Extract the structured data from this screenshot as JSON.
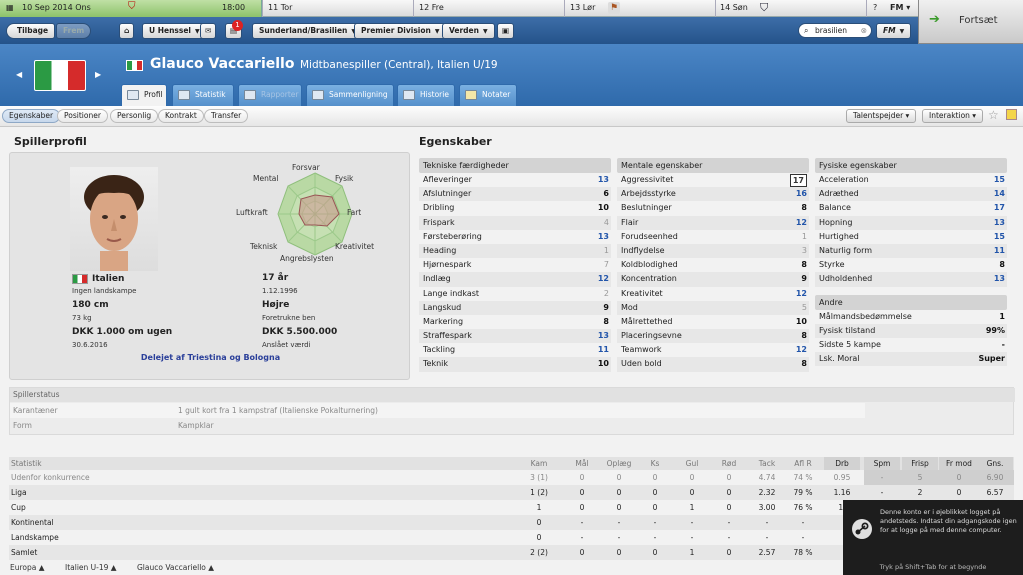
{
  "datebar": {
    "current_date": "10 Sep 2014 Ons",
    "time": "18:00",
    "days": [
      {
        "label": "11 Tor"
      },
      {
        "label": "12 Fre"
      },
      {
        "label": "13 Lør"
      },
      {
        "label": "14 Søn"
      }
    ],
    "help": "?",
    "fm_menu": "FM"
  },
  "nav": {
    "back": "Tilbage",
    "forward": "Frem",
    "manager": "U Henssel",
    "notification_count": "1",
    "club": "Sunderland/Brasilien",
    "league": "Premier Division",
    "world": "Verden",
    "search_value": "brasilien",
    "fm": "FM",
    "continue": "Fortsæt"
  },
  "player": {
    "name": "Glauco Vaccariello",
    "role": "Midtbanespiller (Central), Italien U/19"
  },
  "tabs": [
    {
      "label": "Profil"
    },
    {
      "label": "Statistik"
    },
    {
      "label": "Rapporter"
    },
    {
      "label": "Sammenligning"
    },
    {
      "label": "Historie"
    },
    {
      "label": "Notater"
    }
  ],
  "subtabs": [
    {
      "label": "Egenskaber"
    },
    {
      "label": "Positioner"
    },
    {
      "label": "Personlig"
    },
    {
      "label": "Kontrakt"
    },
    {
      "label": "Transfer"
    }
  ],
  "actions": {
    "scouts": "Talentspejder",
    "interaction": "Interaktion"
  },
  "profile": {
    "title": "Spillerprofil",
    "nationality": "Italien",
    "caps": "Ingen landskampe",
    "age": "17 år",
    "dob": "1.12.1996",
    "height": "180 cm",
    "weight": "73 kg",
    "foot": "Højre",
    "foot_label": "Foretrukne ben",
    "wage": "DKK 1.000 om ugen",
    "contract_end": "30.6.2016",
    "value": "DKK 5.500.000",
    "value_label": "Anslået værdi",
    "owned_by": "Delejet af Triestina og Bologna",
    "radar_labels": [
      "Forsvar",
      "Fysik",
      "Fart",
      "Kreativitet",
      "Angrebslysten",
      "Teknisk",
      "Luftkraft",
      "Mental"
    ]
  },
  "attributes": {
    "title": "Egenskaber",
    "technical": {
      "header": "Tekniske færdigheder",
      "rows": [
        {
          "name": "Afleveringer",
          "value": "13",
          "cls": "b"
        },
        {
          "name": "Afslutninger",
          "value": "6",
          "cls": "k"
        },
        {
          "name": "Dribling",
          "value": "10",
          "cls": "k"
        },
        {
          "name": "Frispark",
          "value": "4",
          "cls": "g"
        },
        {
          "name": "Førsteberøring",
          "value": "13",
          "cls": "b"
        },
        {
          "name": "Heading",
          "value": "1",
          "cls": "g"
        },
        {
          "name": "Hjørnespark",
          "value": "7",
          "cls": "g"
        },
        {
          "name": "Indlæg",
          "value": "12",
          "cls": "b"
        },
        {
          "name": "Lange indkast",
          "value": "2",
          "cls": "g"
        },
        {
          "name": "Langskud",
          "value": "9",
          "cls": "k"
        },
        {
          "name": "Markering",
          "value": "8",
          "cls": "k"
        },
        {
          "name": "Straffespark",
          "value": "13",
          "cls": "b"
        },
        {
          "name": "Tackling",
          "value": "11",
          "cls": "b"
        },
        {
          "name": "Teknik",
          "value": "10",
          "cls": "k"
        }
      ]
    },
    "mental": {
      "header": "Mentale egenskaber",
      "rows": [
        {
          "name": "Aggressivitet",
          "value": "17",
          "cls": "box"
        },
        {
          "name": "Arbejdsstyrke",
          "value": "16",
          "cls": "b"
        },
        {
          "name": "Beslutninger",
          "value": "8",
          "cls": "k"
        },
        {
          "name": "Flair",
          "value": "12",
          "cls": "b"
        },
        {
          "name": "Forudseenhed",
          "value": "1",
          "cls": "g"
        },
        {
          "name": "Indflydelse",
          "value": "3",
          "cls": "g"
        },
        {
          "name": "Koldblodighed",
          "value": "8",
          "cls": "k"
        },
        {
          "name": "Koncentration",
          "value": "9",
          "cls": "k"
        },
        {
          "name": "Kreativitet",
          "value": "12",
          "cls": "b"
        },
        {
          "name": "Mod",
          "value": "5",
          "cls": "g"
        },
        {
          "name": "Målrettethed",
          "value": "10",
          "cls": "k"
        },
        {
          "name": "Placeringsevne",
          "value": "8",
          "cls": "k"
        },
        {
          "name": "Teamwork",
          "value": "12",
          "cls": "b"
        },
        {
          "name": "Uden bold",
          "value": "8",
          "cls": "k"
        }
      ]
    },
    "physical": {
      "header": "Fysiske egenskaber",
      "rows": [
        {
          "name": "Acceleration",
          "value": "15",
          "cls": "b"
        },
        {
          "name": "Adræthed",
          "value": "14",
          "cls": "b"
        },
        {
          "name": "Balance",
          "value": "17",
          "cls": "b"
        },
        {
          "name": "Hopning",
          "value": "13",
          "cls": "b"
        },
        {
          "name": "Hurtighed",
          "value": "15",
          "cls": "b"
        },
        {
          "name": "Naturlig form",
          "value": "11",
          "cls": "b"
        },
        {
          "name": "Styrke",
          "value": "8",
          "cls": "k"
        },
        {
          "name": "Udholdenhed",
          "value": "13",
          "cls": "b"
        }
      ]
    },
    "other": {
      "header": "Andre",
      "rows": [
        {
          "name": "Målmandsbedømmelse",
          "value": "1",
          "cls": "k"
        },
        {
          "name": "Fysisk tilstand",
          "value": "99%",
          "cls": "k"
        },
        {
          "name": "Sidste 5 kampe",
          "value": "-",
          "cls": "k"
        },
        {
          "name": "Lsk. Moral",
          "value": "Super",
          "cls": "k"
        }
      ]
    }
  },
  "status": {
    "header": "Spillerstatus",
    "rows": [
      {
        "label": "Karantæner",
        "value": "1 gult kort fra 1 kampstraf (Italienske Pokalturnering)"
      },
      {
        "label": "Form",
        "value": "Kampklar"
      }
    ]
  },
  "stats": {
    "columns": [
      "Statistik",
      "Kam",
      "Mål",
      "Oplæg",
      "Ks",
      "Gul",
      "Rød",
      "Tack",
      "Afl R",
      "Drb",
      "Spm",
      "Frisp",
      "Fr mod",
      "Gns."
    ],
    "rows": [
      [
        "Udenfor konkurrence",
        "3 (1)",
        "0",
        "0",
        "0",
        "0",
        "0",
        "4.74",
        "74 %",
        "0.95",
        "-",
        "5",
        "0",
        "6.90"
      ],
      [
        "Liga",
        "1 (2)",
        "0",
        "0",
        "0",
        "0",
        "0",
        "2.32",
        "79 %",
        "1.16",
        "-",
        "2",
        "0",
        "6.57"
      ],
      [
        "Cup",
        "1",
        "0",
        "0",
        "0",
        "1",
        "0",
        "3.00",
        "76 %",
        "1.",
        "",
        "",
        "",
        ""
      ],
      [
        "Kontinental",
        "0",
        "-",
        "-",
        "-",
        "-",
        "-",
        "-",
        "-",
        "",
        "",
        "",
        "",
        ""
      ],
      [
        "Landskampe",
        "0",
        "-",
        "-",
        "-",
        "-",
        "-",
        "-",
        "-",
        "",
        "",
        "",
        "",
        ""
      ],
      [
        "Samlet",
        "2 (2)",
        "0",
        "0",
        "0",
        "1",
        "0",
        "2.57",
        "78 %",
        "",
        "",
        "",
        "",
        ""
      ]
    ]
  },
  "footer": {
    "crumbs": [
      "Europa",
      "Italien U-19",
      "Glauco Vaccariello"
    ]
  },
  "steam": {
    "message": "Denne konto er i øjeblikket logget på andetsteds. Indtast din adgangskode igen for at logge på med denne computer.",
    "hint": "Tryk på Shift+Tab for at begynde"
  }
}
